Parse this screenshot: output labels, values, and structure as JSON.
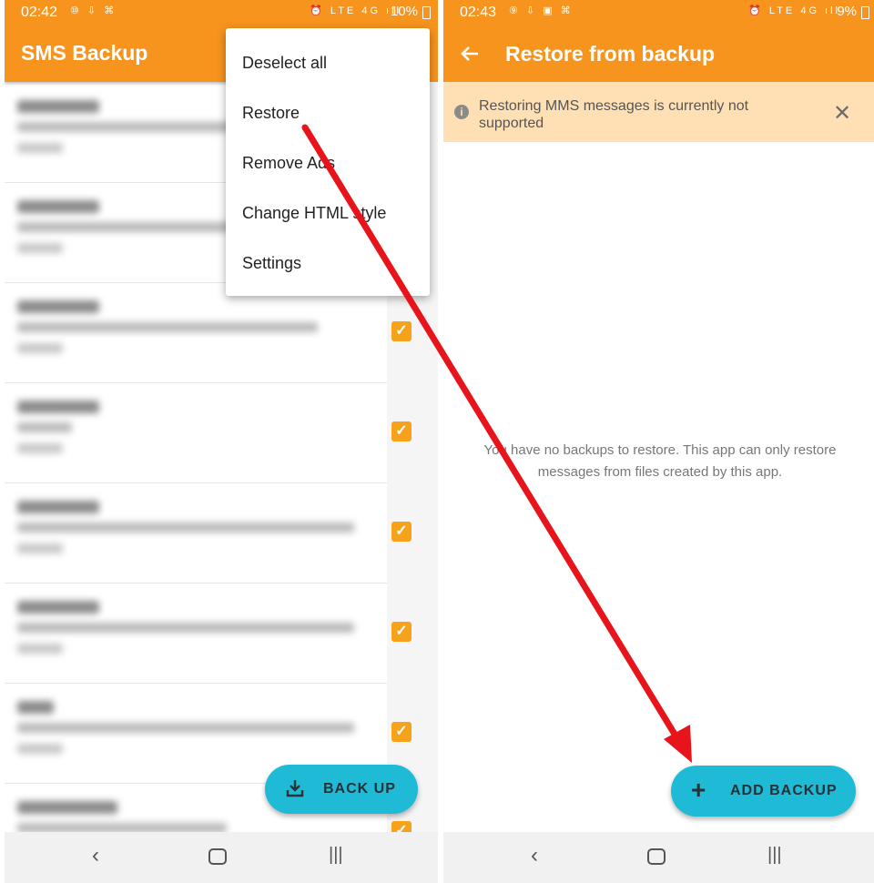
{
  "left_screen": {
    "status_bar": {
      "time": "02:42",
      "left_icons": "⑩ ⇩ ⌘",
      "right_icons": "⏰ LTE 4G ıll",
      "battery": "10%"
    },
    "app_title": "SMS Backup",
    "overflow_menu": [
      "Deselect all",
      "Restore",
      "Remove Ads",
      "Change HTML style",
      "Settings"
    ],
    "fab_label": "BACK UP"
  },
  "right_screen": {
    "status_bar": {
      "time": "02:43",
      "left_icons": "⑨ ⇩ ▣ ⌘",
      "right_icons": "⏰ LTE 4G ıll",
      "battery": "9%"
    },
    "app_title": "Restore from backup",
    "banner_text": "Restoring MMS messages is currently not supported",
    "empty_text": "You have no backups to restore. This app can only restore messages from files created by this app.",
    "fab_label": "ADD BACKUP"
  },
  "icons": {
    "back": "back-arrow-icon",
    "info": "info-icon",
    "close": "close-icon",
    "download": "download-icon",
    "plus": "plus-icon",
    "check": "checkbox-checked-icon",
    "nav_back": "nav-back-icon",
    "nav_home": "nav-home-icon",
    "nav_recent": "nav-recent-icon"
  },
  "colors": {
    "accent": "#f7941d",
    "fab": "#1fbad6",
    "banner": "#ffe0b5",
    "annotation_arrow": "#e8141b",
    "checkbox": "#f7a21b"
  }
}
